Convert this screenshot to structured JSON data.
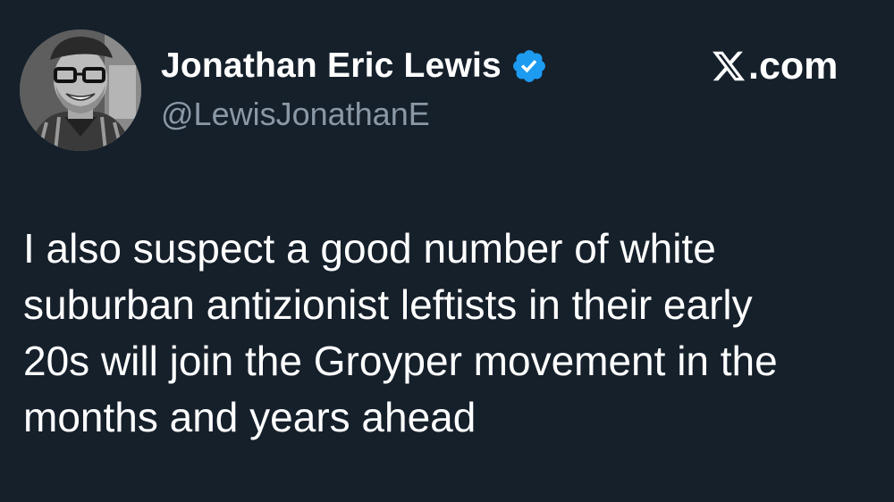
{
  "author": {
    "display_name": "Jonathan Eric Lewis",
    "handle": "@LewisJonathanE",
    "verified": true,
    "avatar_icon": "profile-photo"
  },
  "brand": {
    "label": ".com",
    "logo_icon": "x-logo-icon"
  },
  "tweet": {
    "lines": [
      "I also suspect a good number of white",
      "suburban antizionist leftists in their early",
      "20s will join the Groyper movement in the",
      "months and years ahead"
    ]
  },
  "colors": {
    "background": "#15202b",
    "text": "#ffffff",
    "handle": "#8b98a5",
    "verified_badge": "#1d9bf0"
  }
}
